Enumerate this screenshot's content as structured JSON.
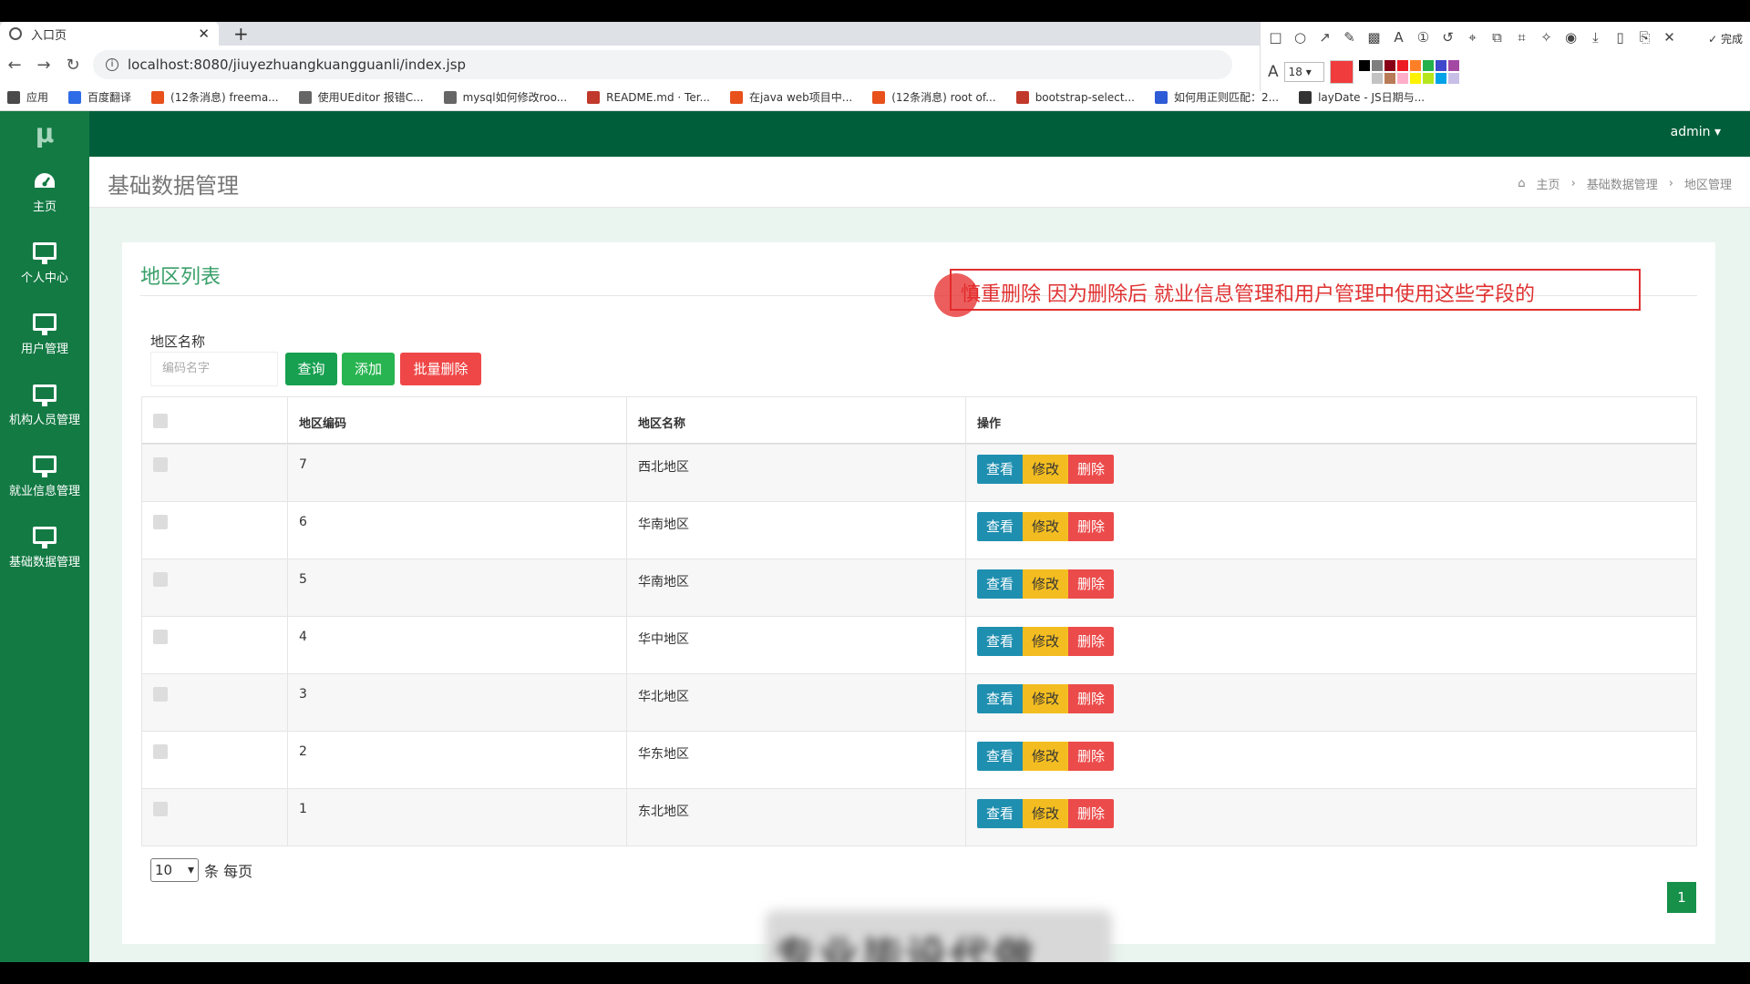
{
  "browser": {
    "tab_title": "入口页",
    "url": "localhost:8080/jiuyezhuangkuangguanli/index.jsp",
    "bookmarks": [
      {
        "label": "应用",
        "color": "#4a4a4a"
      },
      {
        "label": "百度翻译",
        "color": "#2e6be6"
      },
      {
        "label": "(12条消息) freema...",
        "color": "#e8501c"
      },
      {
        "label": "使用UEditor 报错C...",
        "color": "#666666"
      },
      {
        "label": "mysql如何修改roo...",
        "color": "#666666"
      },
      {
        "label": "README.md · Ter...",
        "color": "#c0392b"
      },
      {
        "label": "在java web项目中...",
        "color": "#e8501c"
      },
      {
        "label": "(12条消息) root of...",
        "color": "#e8501c"
      },
      {
        "label": "bootstrap-select...",
        "color": "#c0392b"
      },
      {
        "label": "如何用正则匹配：2...",
        "color": "#2e5bd6"
      },
      {
        "label": "layDate - JS日期与...",
        "color": "#333333"
      }
    ]
  },
  "annotation_toolbar": {
    "font_size": "18",
    "done_label": "完成",
    "current_color": "#f03c3c",
    "palette": [
      "#000000",
      "#7f7f7f",
      "#880015",
      "#ed1c24",
      "#ff7f27",
      "#22b14c",
      "#3f48cc",
      "#a349a4",
      "#ffffff",
      "#c3c3c3",
      "#b97a57",
      "#ffaec9",
      "#fff200",
      "#b5e61d",
      "#00a2e8",
      "#c8bfe7"
    ]
  },
  "app": {
    "logo": "μ",
    "user": "admin ▾",
    "sidebar": [
      {
        "label": "主页",
        "icon": "dashboard-icon"
      },
      {
        "label": "个人中心",
        "icon": "monitor-icon"
      },
      {
        "label": "用户管理",
        "icon": "monitor-icon"
      },
      {
        "label": "机构人员管理",
        "icon": "monitor-icon"
      },
      {
        "label": "就业信息管理",
        "icon": "monitor-icon"
      },
      {
        "label": "基础数据管理",
        "icon": "monitor-icon"
      }
    ],
    "page_title": "基础数据管理",
    "breadcrumb": [
      "主页",
      "基础数据管理",
      "地区管理"
    ],
    "panel_title": "地区列表",
    "annotation_text": "慎重删除 因为删除后 就业信息管理和用户管理中使用这些字段的",
    "filter": {
      "label": "地区名称",
      "placeholder": "编码名字"
    },
    "buttons": {
      "query": "查询",
      "add": "添加",
      "batch_delete": "批量删除"
    },
    "table": {
      "headers": [
        "地区编码",
        "地区名称",
        "操作"
      ],
      "rows": [
        {
          "code": "7",
          "name": "西北地区"
        },
        {
          "code": "6",
          "name": "华南地区"
        },
        {
          "code": "5",
          "name": "华南地区"
        },
        {
          "code": "4",
          "name": "华中地区"
        },
        {
          "code": "3",
          "name": "华北地区"
        },
        {
          "code": "2",
          "name": "华东地区"
        },
        {
          "code": "1",
          "name": "东北地区"
        }
      ],
      "actions": {
        "view": "查看",
        "edit": "修改",
        "delete": "删除"
      }
    },
    "pagination": {
      "page_size": "10",
      "page_size_suffix": "条 每页",
      "current_page": "1"
    },
    "watermark": "专业毕设代做"
  }
}
